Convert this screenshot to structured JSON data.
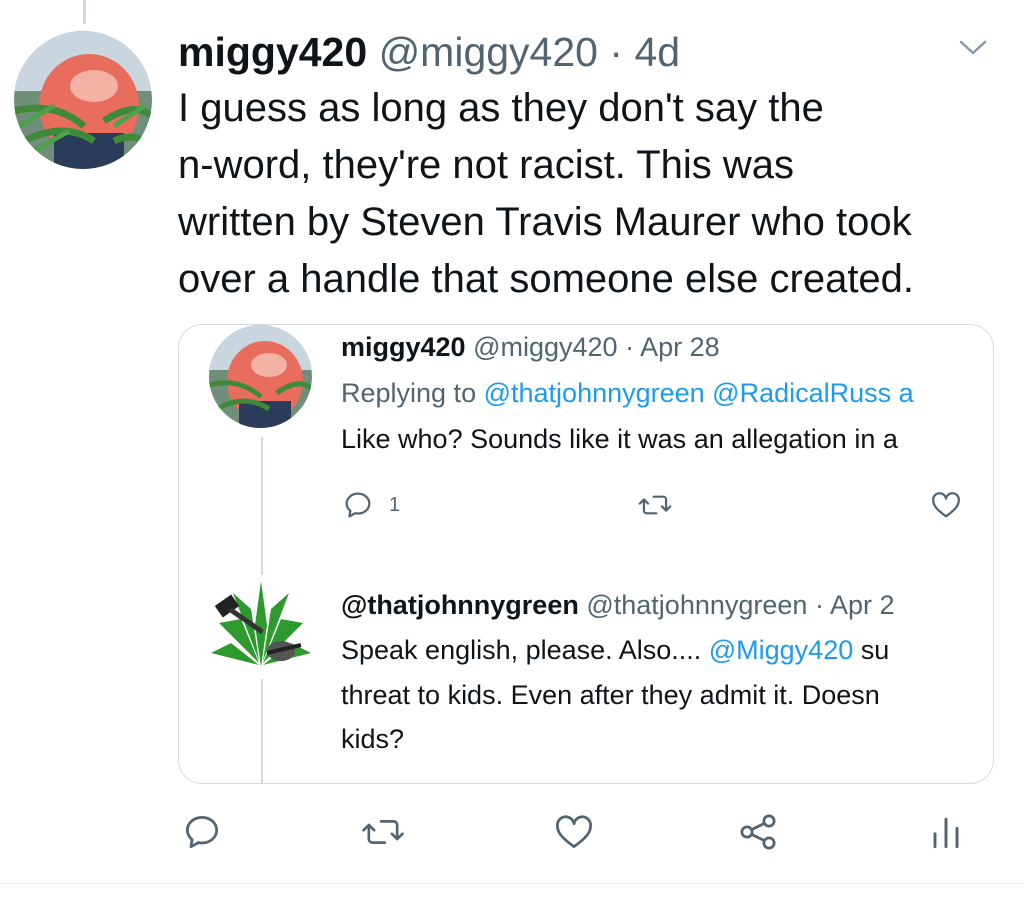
{
  "tweet": {
    "display_name": "miggy420",
    "handle": "@miggy420",
    "separator": "·",
    "time": "4d",
    "text_lines": [
      "I guess as long as they don't say the",
      "n-word, they're not racist. This was",
      "written by Steven Travis Maurer who took",
      "over a handle that someone else created."
    ]
  },
  "quote": {
    "first": {
      "display_name": "miggy420",
      "handle": "@miggy420",
      "separator": "·",
      "time": "Apr 28",
      "replying_label": "Replying to",
      "reply_handles": "@thatjohnnygreen @RadicalRuss a",
      "text": "Like who? Sounds like it was an allegation in a",
      "reply_count": "1"
    },
    "second": {
      "display_name": "@thatjohnnygreen",
      "handle": "@thatjohnnygreen",
      "separator": "·",
      "time": "Apr 2",
      "text_line1_prefix": "Speak english, please. Also....",
      "text_line1_mention": "@Miggy420",
      "text_line1_suffix": "su",
      "text_line2": "threat to kids. Even after they admit it. Doesn",
      "text_line3": "kids?"
    }
  },
  "icons": {
    "chevron": "chevron-down-icon",
    "reply": "reply-icon",
    "retweet": "retweet-icon",
    "like": "heart-icon",
    "share": "share-icon",
    "analytics": "analytics-icon"
  },
  "colors": {
    "link": "#1d9bf0",
    "muted": "#536471",
    "text": "#0f1419",
    "border": "#d4dbe0"
  }
}
